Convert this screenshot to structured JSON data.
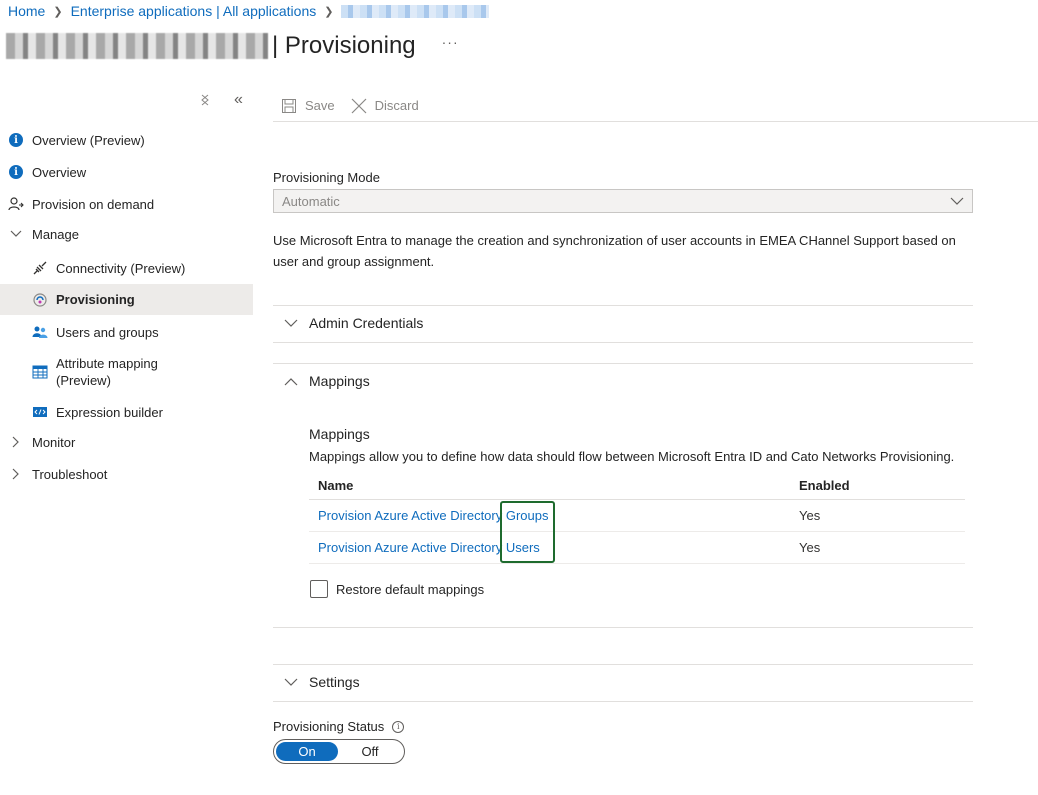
{
  "breadcrumb": {
    "home": "Home",
    "enterprise_apps": "Enterprise applications | All applications"
  },
  "header": {
    "title": "| Provisioning",
    "more": "···"
  },
  "sidebar": {
    "items": [
      {
        "label": "Overview (Preview)",
        "icon": "info-icon"
      },
      {
        "label": "Overview",
        "icon": "info-icon"
      },
      {
        "label": "Provision on demand",
        "icon": "provision-user-icon"
      },
      {
        "label": "Manage",
        "icon": "chevron-down-icon"
      },
      {
        "label": "Connectivity (Preview)",
        "icon": "plug-icon"
      },
      {
        "label": "Provisioning",
        "icon": "provisioning-icon",
        "selected": true
      },
      {
        "label": "Users and groups",
        "icon": "users-icon"
      },
      {
        "label": "Attribute mapping",
        "label2": "(Preview)",
        "icon": "attribute-mapping-icon"
      },
      {
        "label": "Expression builder",
        "icon": "expression-builder-icon"
      },
      {
        "label": "Monitor",
        "icon": "chevron-right-icon"
      },
      {
        "label": "Troubleshoot",
        "icon": "chevron-right-icon"
      }
    ]
  },
  "toolbar": {
    "save_label": "Save",
    "discard_label": "Discard"
  },
  "form": {
    "mode_label": "Provisioning Mode",
    "mode_value": "Automatic",
    "description": "Use Microsoft Entra to manage the creation and synchronization of user accounts in EMEA CHannel Support based on user and group assignment."
  },
  "sections": {
    "admin_credentials": "Admin Credentials",
    "mappings": "Mappings",
    "settings": "Settings"
  },
  "mappings": {
    "title": "Mappings",
    "description": "Mappings allow you to define how data should flow between Microsoft Entra ID and Cato Networks Provisioning.",
    "columns": [
      "Name",
      "Enabled"
    ],
    "rows": [
      {
        "name": "Provision Azure Active Directory Groups",
        "enabled": "Yes"
      },
      {
        "name": "Provision Azure Active Directory Users",
        "enabled": "Yes"
      }
    ],
    "restore_label": "Restore default mappings"
  },
  "status": {
    "label": "Provisioning Status",
    "on": "On",
    "off": "Off",
    "value": "On"
  },
  "colors": {
    "accent": "#0f6cbd",
    "highlight_box": "#1e6b2e",
    "selected_bg": "#edebe9"
  }
}
